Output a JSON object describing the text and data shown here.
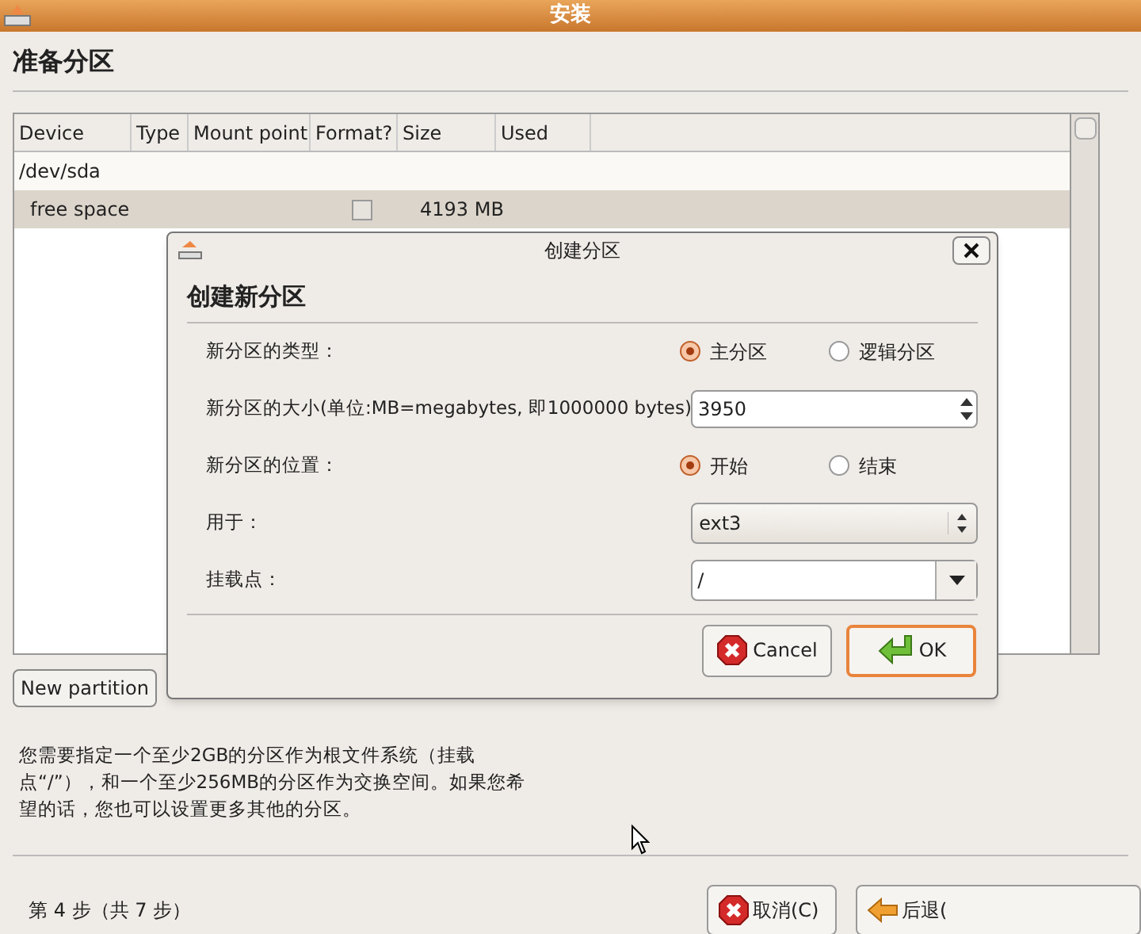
{
  "window": {
    "title": "安装"
  },
  "heading": "准备分区",
  "table": {
    "columns": [
      "Device",
      "Type",
      "Mount point",
      "Format?",
      "Size",
      "Used"
    ],
    "rows": [
      {
        "kind": "disk",
        "device": "/dev/sda",
        "selected": false
      },
      {
        "kind": "partition",
        "device": "free space",
        "format_checked": false,
        "size": "4193 MB",
        "selected": true
      }
    ]
  },
  "new_partition_button": "New partition",
  "description": "您需要指定一个至少2GB的分区作为根文件系统（挂载点“/”），和一个至少256MB的分区作为交换空间。如果您希望的话，您也可以设置更多其他的分区。",
  "step": "第 4 步（共 7 步）",
  "buttons": [
    {
      "kind": "cancel",
      "label": "取消(C)"
    },
    {
      "kind": "back",
      "label": "后退("
    }
  ],
  "dialog": {
    "title": "创建分区",
    "heading": "创建新分区",
    "fields": [
      {
        "kind": "radio",
        "label": "新分区的类型：",
        "options": [
          {
            "label": "主分区",
            "selected": true
          },
          {
            "label": "逻辑分区",
            "selected": false
          }
        ]
      },
      {
        "kind": "spin",
        "label": "新分区的大小(单位:MB=megabytes, 即1000000 bytes)",
        "value": "3950"
      },
      {
        "kind": "radio",
        "label": "新分区的位置：",
        "options": [
          {
            "label": "开始",
            "selected": true
          },
          {
            "label": "结束",
            "selected": false
          }
        ]
      },
      {
        "kind": "select",
        "label": "用于：",
        "value": "ext3"
      },
      {
        "kind": "combo",
        "label": "挂载点：",
        "value": "/"
      }
    ],
    "buttons": [
      {
        "kind": "cancel",
        "label": "Cancel"
      },
      {
        "kind": "ok",
        "label": "OK"
      }
    ]
  }
}
